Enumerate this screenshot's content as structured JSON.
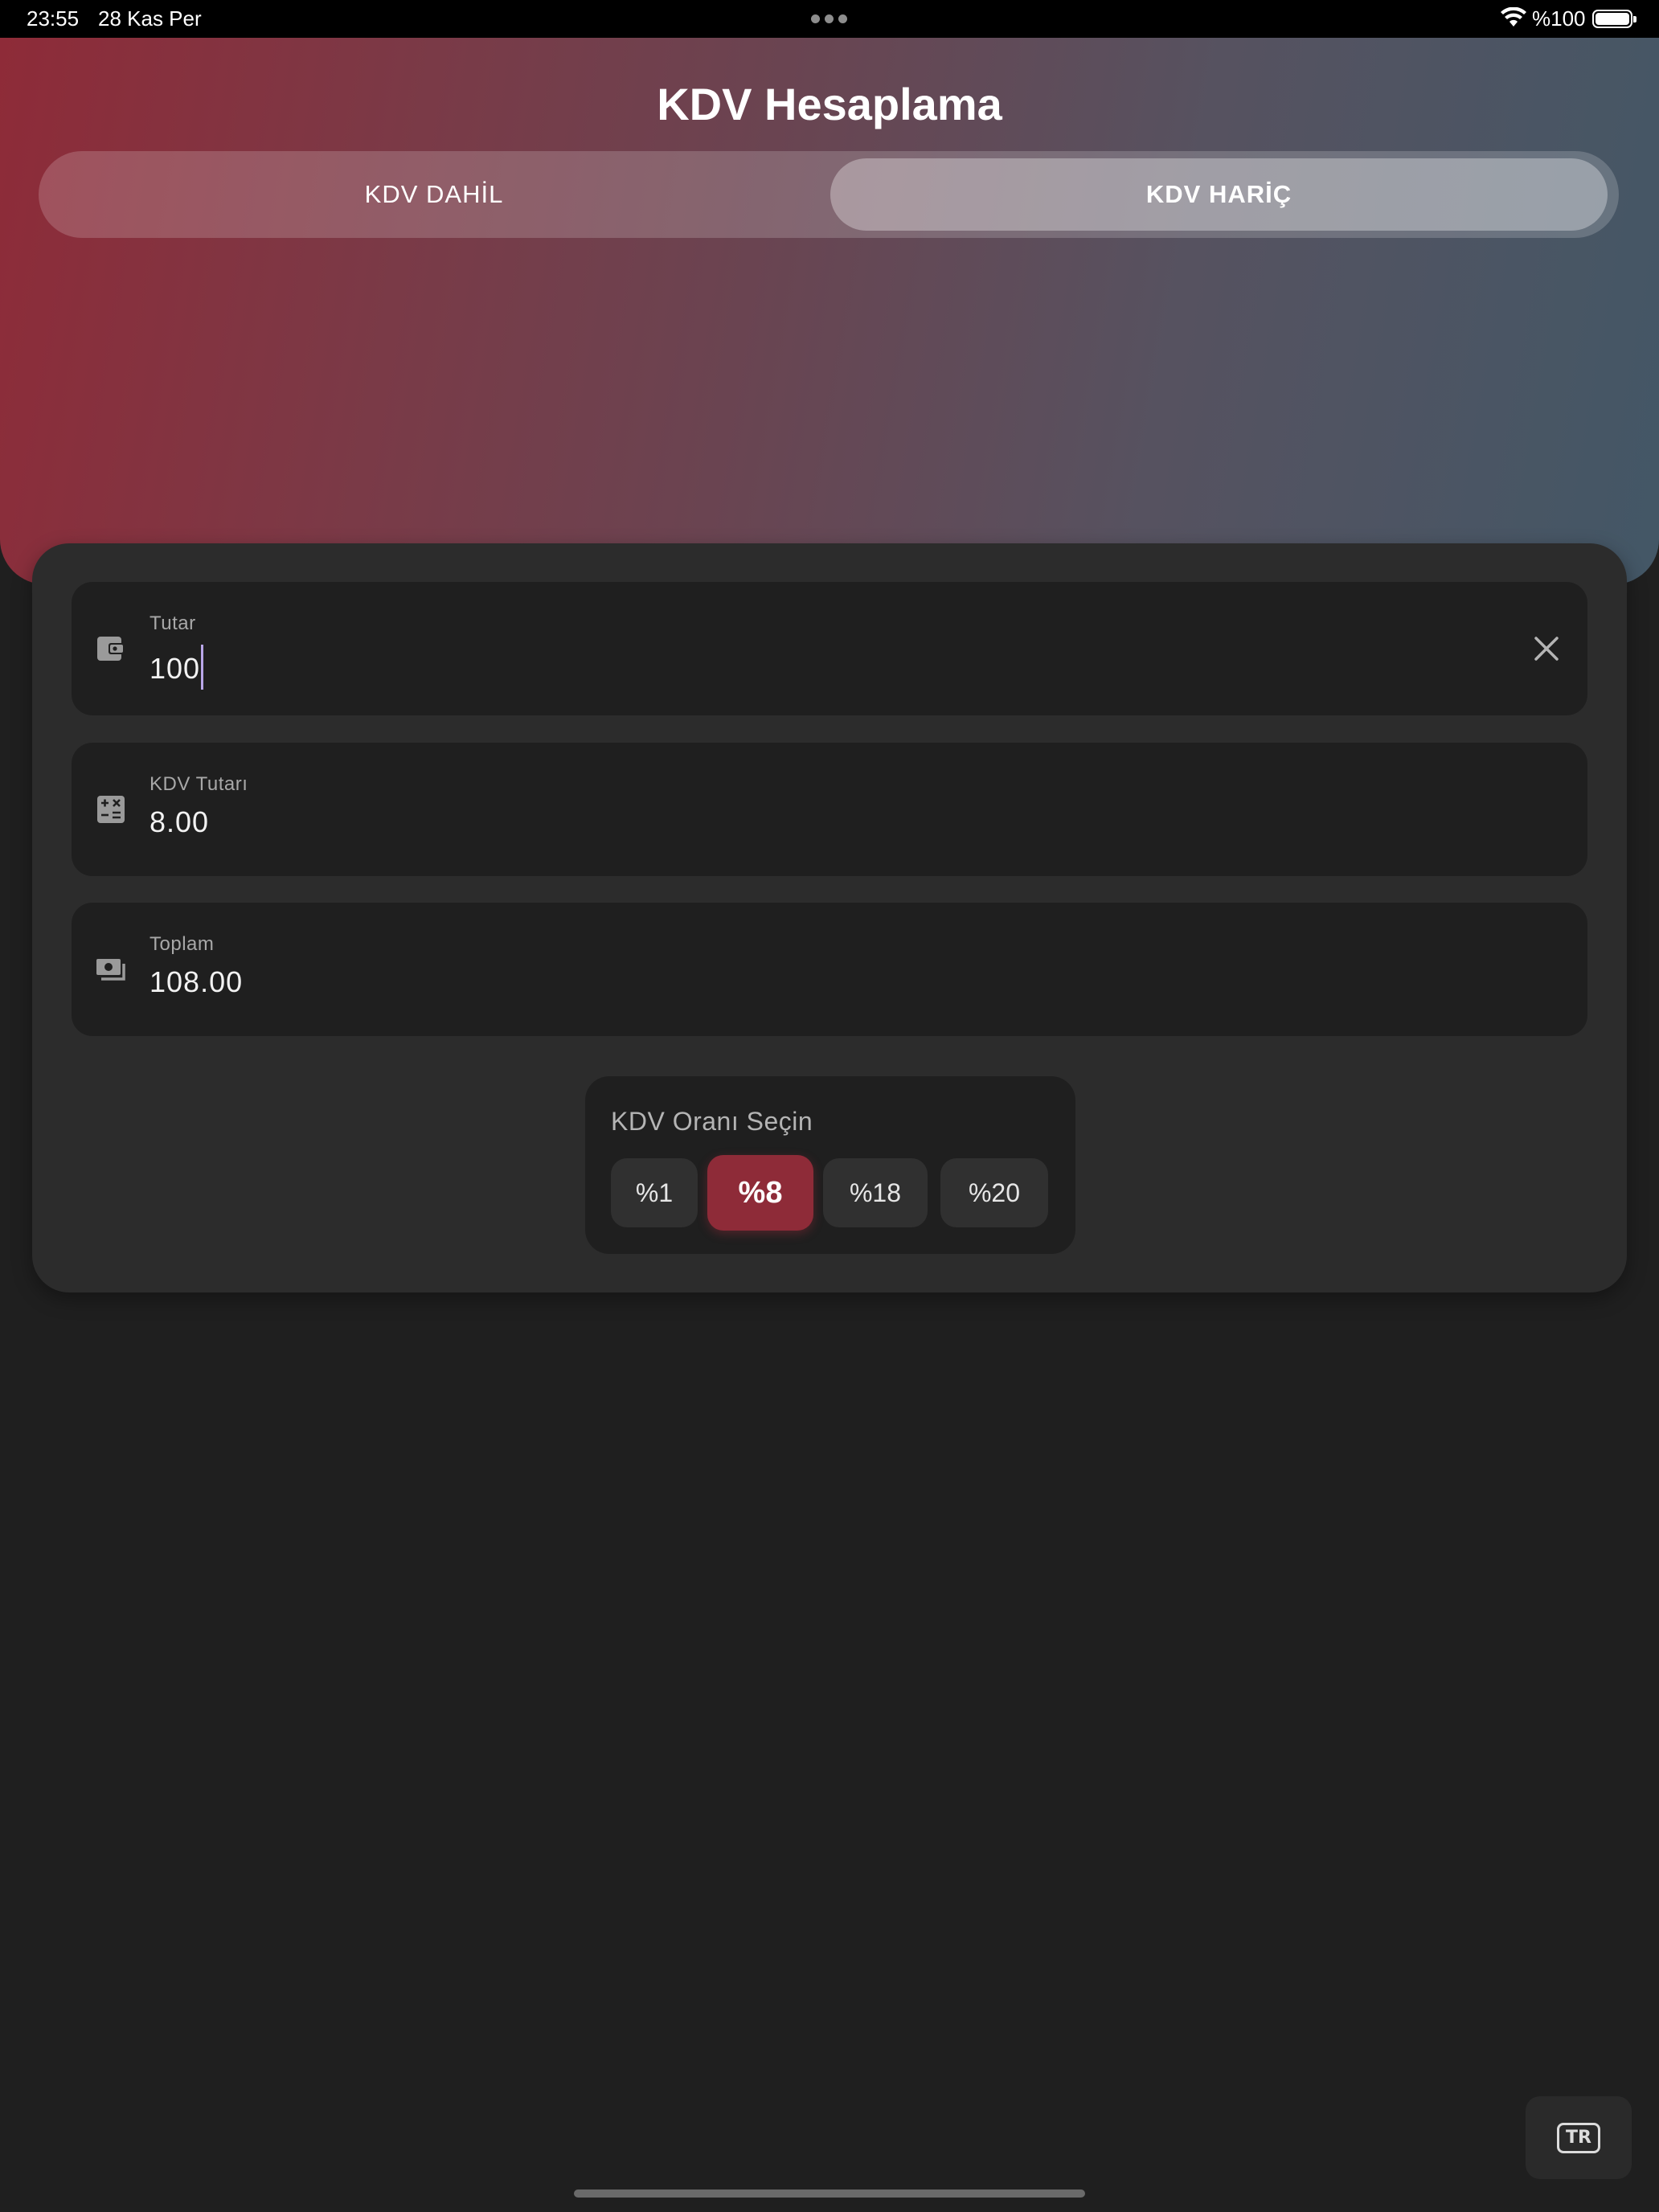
{
  "status_bar": {
    "time": "23:55",
    "date": "28 Kas Per",
    "battery_label": "%100",
    "icons": [
      "more-dots-icon",
      "wifi-icon",
      "battery-icon"
    ]
  },
  "header": {
    "title": "KDV Hesaplama",
    "tabs": [
      {
        "label": "KDV DAHİL",
        "selected": false
      },
      {
        "label": "KDV HARİÇ",
        "selected": true
      }
    ]
  },
  "form": {
    "amount": {
      "label": "Tutar",
      "value": "100",
      "icon": "wallet-icon"
    },
    "vat_amount": {
      "label": "KDV Tutarı",
      "value": "8.00",
      "icon": "calculator-icon"
    },
    "total": {
      "label": "Toplam",
      "value": "108.00",
      "icon": "money-icon"
    }
  },
  "rate_selector": {
    "title": "KDV Oranı Seçin",
    "options": [
      {
        "label": "%1",
        "selected": false
      },
      {
        "label": "%8",
        "selected": true
      },
      {
        "label": "%18",
        "selected": false
      },
      {
        "label": "%20",
        "selected": false
      }
    ]
  },
  "language": {
    "label": "TR"
  },
  "colors": {
    "accent": "#8e2b38",
    "background": "#1f1f1f",
    "card": "#2c2c2c",
    "caret": "#b9a6e8"
  }
}
